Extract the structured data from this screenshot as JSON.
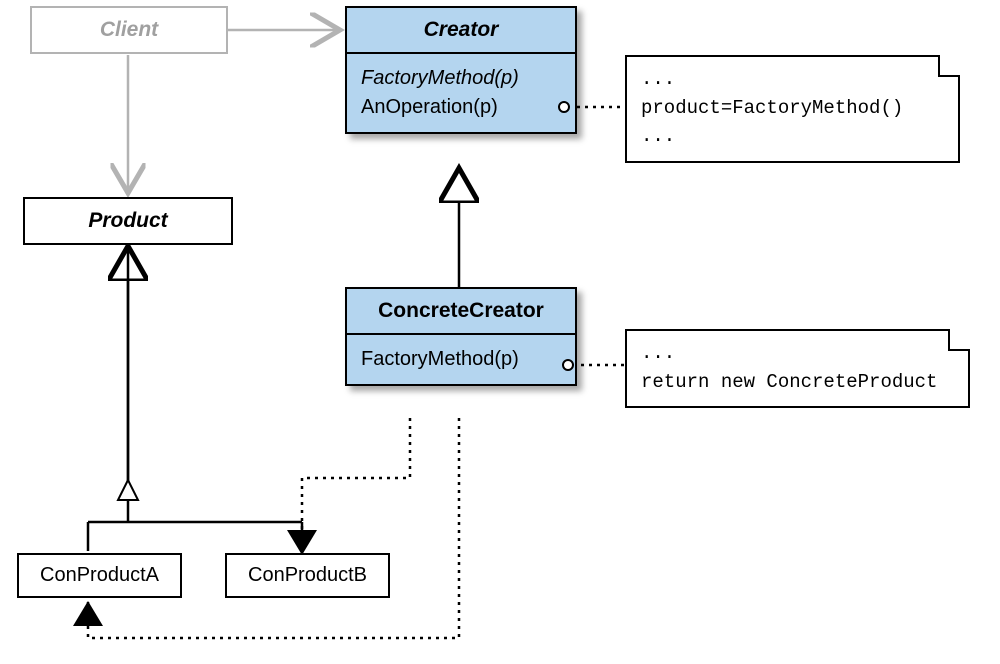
{
  "client": {
    "title": "Client"
  },
  "creator": {
    "title": "Creator",
    "line1": "FactoryMethod(p)",
    "line2": "AnOperation(p)"
  },
  "concreteCreator": {
    "title": "ConcreteCreator",
    "line1": "FactoryMethod(p)"
  },
  "product": {
    "title": "Product"
  },
  "conA": {
    "label": "ConProductA"
  },
  "conB": {
    "label": "ConProductB"
  },
  "note1": {
    "l1": "...",
    "l2": "product=FactoryMethod()",
    "l3": "..."
  },
  "note2": {
    "l1": "...",
    "l2": "return new ConcreteProduct"
  }
}
